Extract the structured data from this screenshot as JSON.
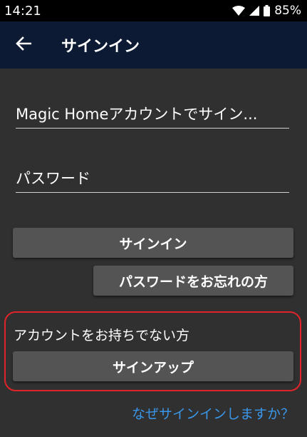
{
  "status_bar": {
    "time": "14:21",
    "battery": "85%",
    "icons": [
      "wifi-icon",
      "cell-signal-icon",
      "battery-icon"
    ]
  },
  "app_bar": {
    "title": "サインイン",
    "back_icon": "back-arrow-icon",
    "background": "#0c1a33"
  },
  "form": {
    "email_placeholder": "Magic Homeアカウントでサイン...",
    "password_placeholder": "パスワード"
  },
  "buttons": {
    "signin": "サインイン",
    "forgot_password": "パスワードをお忘れの方",
    "signup": "サインアップ"
  },
  "signup_section": {
    "prompt": "アカウントをお持ちでない方",
    "highlight_color": "#e0242a"
  },
  "links": {
    "why_signin": "なぜサインインしますか？",
    "link_color": "#3a96e8"
  }
}
